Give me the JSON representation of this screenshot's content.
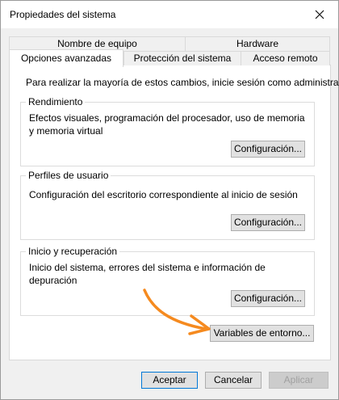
{
  "window": {
    "title": "Propiedades del sistema"
  },
  "tabs_back": [
    {
      "label": "Nombre de equipo"
    },
    {
      "label": "Hardware"
    }
  ],
  "tabs_front": [
    {
      "label": "Opciones avanzadas",
      "active": true
    },
    {
      "label": "Protección del sistema"
    },
    {
      "label": "Acceso remoto"
    }
  ],
  "panel": {
    "intro": "Para realizar la mayoría de estos cambios, inicie sesión como administrador.",
    "performance": {
      "label": "Rendimiento",
      "text": "Efectos visuales, programación del procesador, uso de memoria y memoria virtual",
      "button": "Configuración..."
    },
    "user_profiles": {
      "label": "Perfiles de usuario",
      "text": "Configuración del escritorio correspondiente al inicio de sesión",
      "button": "Configuración..."
    },
    "startup_recovery": {
      "label": "Inicio y recuperación",
      "text": "Inicio del sistema, errores del sistema e información de depuración",
      "button": "Configuración..."
    },
    "env_button": "Variables de entorno..."
  },
  "footer": {
    "accept": "Aceptar",
    "cancel": "Cancelar",
    "apply": "Aplicar"
  },
  "colors": {
    "arrow": "#f58a1f",
    "focus_border": "#0078d7"
  },
  "icons": {
    "close": "close-icon",
    "annotation": "arrow-annotation-icon"
  }
}
